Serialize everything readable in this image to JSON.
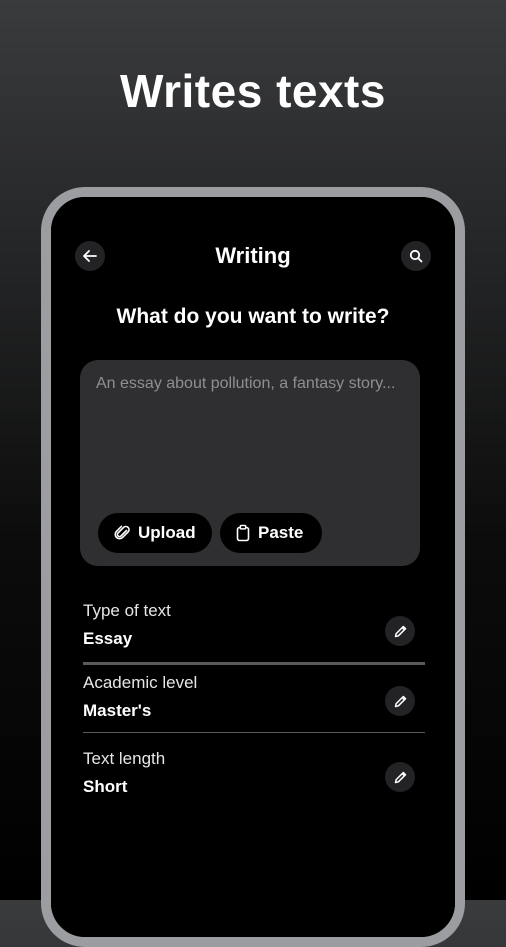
{
  "promo": {
    "headline": "Writes texts"
  },
  "header": {
    "title": "Writing",
    "back_icon": "arrow-left-icon",
    "search_icon": "search-icon"
  },
  "prompt": {
    "question": "What do you want to write?",
    "placeholder": "An essay about pollution, a fantasy story...",
    "value": "",
    "upload_label": "Upload",
    "paste_label": "Paste"
  },
  "settings": [
    {
      "label": "Type of text",
      "value": "Essay"
    },
    {
      "label": "Academic level",
      "value": "Master's"
    },
    {
      "label": "Text length",
      "value": "Short"
    }
  ],
  "colors": {
    "card_bg": "#2f2f31",
    "button_bg": "#232325",
    "frame": "#9c9da0",
    "placeholder": "#8f8f93"
  }
}
